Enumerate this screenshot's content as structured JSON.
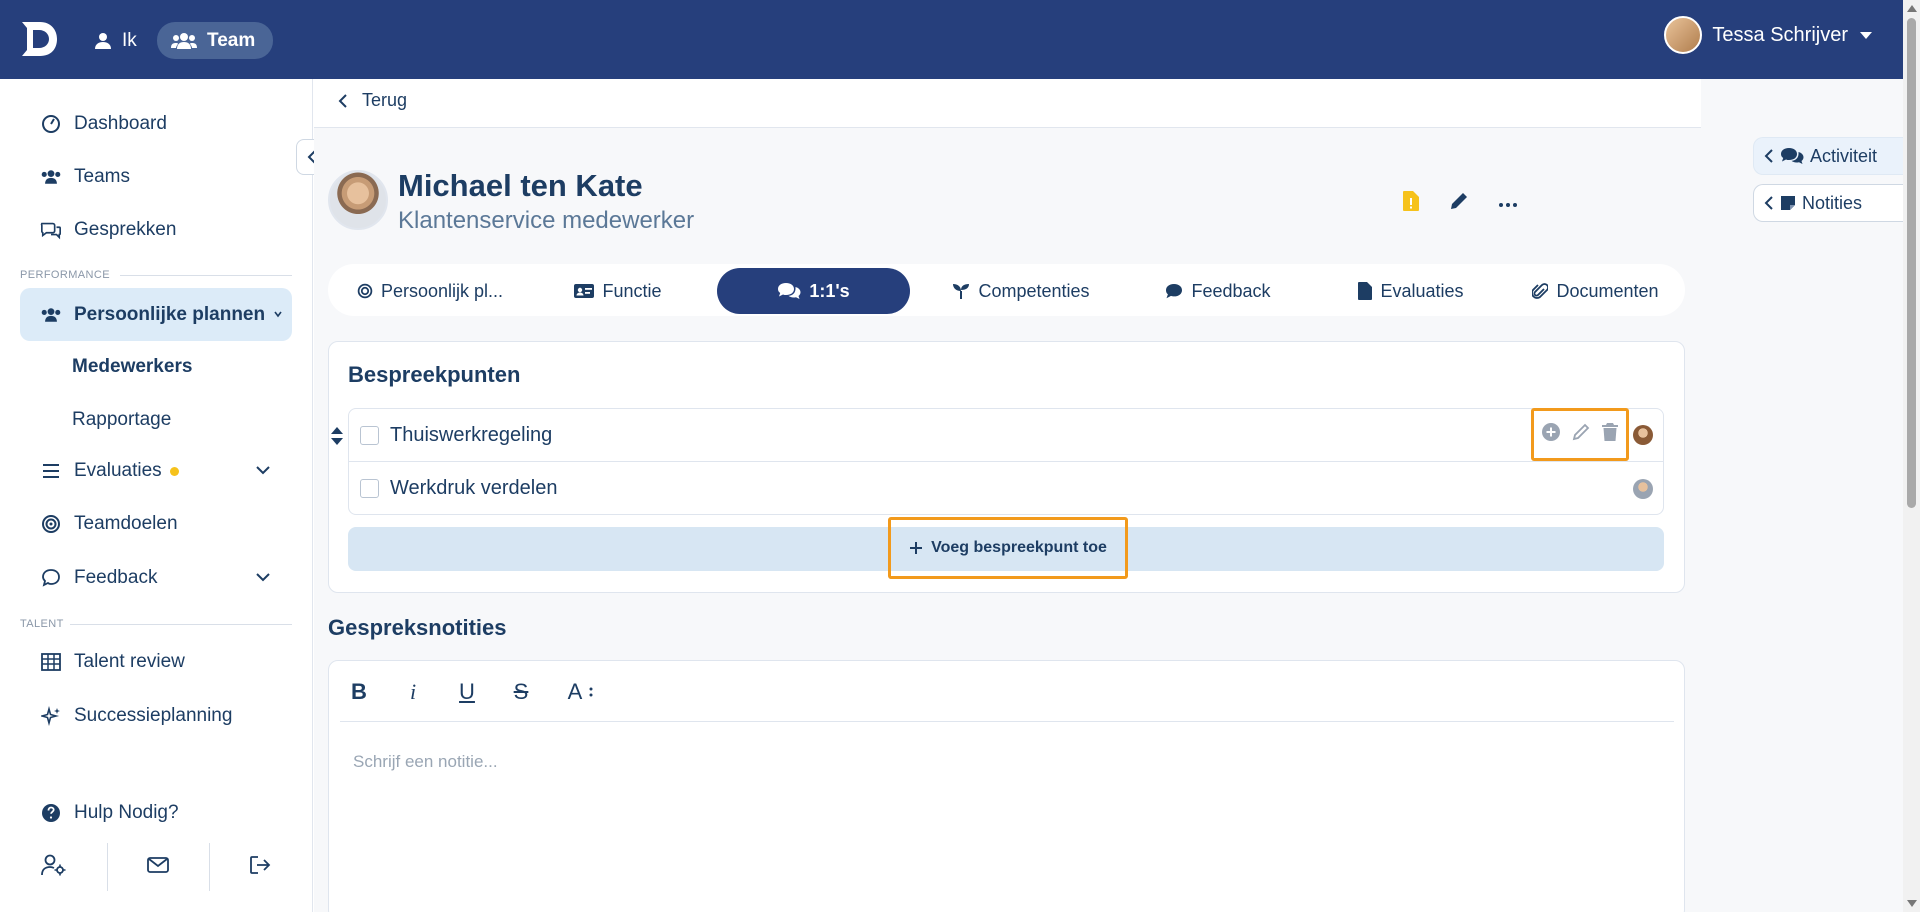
{
  "topbar": {
    "me_label": "Ik",
    "team_label": "Team",
    "user_name": "Tessa Schrijver"
  },
  "sidebar": {
    "items": {
      "dashboard": "Dashboard",
      "teams": "Teams",
      "gesprekken": "Gesprekken",
      "persoonlijke_plannen": "Persoonlijke plannen",
      "medewerkers": "Medewerkers",
      "rapportage": "Rapportage",
      "evaluaties": "Evaluaties",
      "teamdoelen": "Teamdoelen",
      "feedback": "Feedback",
      "talent_review": "Talent review",
      "successieplanning": "Successieplanning",
      "hulp": "Hulp Nodig?"
    },
    "sections": {
      "performance": "PERFORMANCE",
      "talent": "TALENT"
    }
  },
  "back": {
    "label": "Terug"
  },
  "profile": {
    "name": "Michael ten Kate",
    "role": "Klantenservice medewerker"
  },
  "tabs": [
    {
      "label": "Persoonlijk pl..."
    },
    {
      "label": "Functie"
    },
    {
      "label": "1:1's"
    },
    {
      "label": "Competenties"
    },
    {
      "label": "Feedback"
    },
    {
      "label": "Evaluaties"
    },
    {
      "label": "Documenten"
    }
  ],
  "bespreekpunten": {
    "title": "Bespreekpunten",
    "items": [
      {
        "text": "Thuiswerkregeling"
      },
      {
        "text": "Werkdruk verdelen"
      }
    ],
    "add_label": "Voeg bespreekpunt toe"
  },
  "notes": {
    "title": "Gespreksnotities",
    "placeholder": "Schrijf een notitie...",
    "toolbar": {
      "bold": "B",
      "italic": "i",
      "underline": "U",
      "strike": "S",
      "size": "A"
    }
  },
  "right_panel": {
    "activity": "Activiteit",
    "notes": "Notities"
  },
  "colors": {
    "topbar": "#263f7c",
    "accent": "#263f7c",
    "highlight": "#f29a1c",
    "warning": "#f6c21b"
  }
}
